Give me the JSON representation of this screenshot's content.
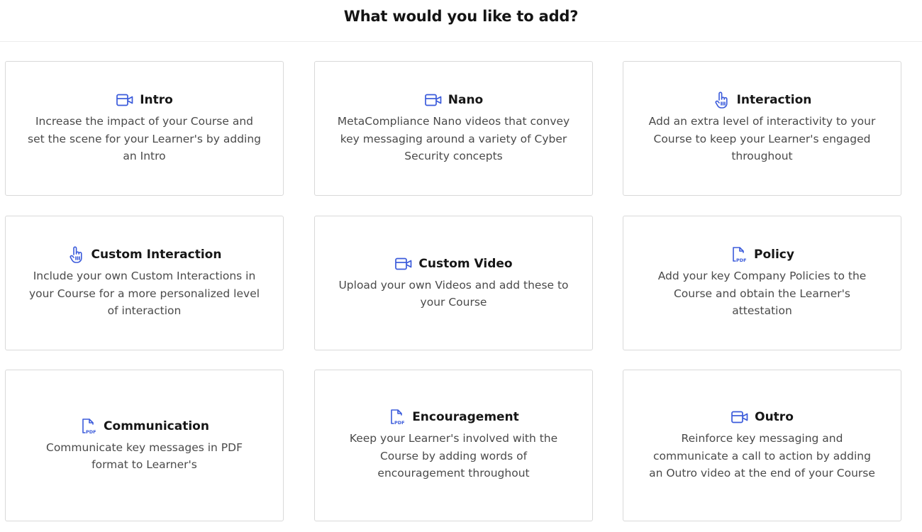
{
  "header": {
    "title": "What would you like to add?"
  },
  "theme": {
    "accent": "#3b5bdb"
  },
  "cards": [
    {
      "title": "Intro",
      "icon": "video-camera-icon",
      "description": "Increase the impact of your Course and set the scene for your Learner's by adding an Intro"
    },
    {
      "title": "Nano",
      "icon": "video-camera-icon",
      "description": "MetaCompliance Nano videos that convey key messaging around a variety of Cyber Security concepts"
    },
    {
      "title": "Interaction",
      "icon": "pointer-hand-icon",
      "description": "Add an extra level of interactivity to your Course to keep your Learner's engaged throughout"
    },
    {
      "title": "Custom Interaction",
      "icon": "pointer-hand-icon",
      "description": "Include your own Custom Interactions in your Course for a more personalized level of interaction"
    },
    {
      "title": "Custom Video",
      "icon": "video-camera-icon",
      "description": "Upload your own Videos and add these to your Course"
    },
    {
      "title": "Policy",
      "icon": "pdf-file-icon",
      "description": "Add your key Company Policies to the Course and obtain the Learner's attestation"
    },
    {
      "title": "Communication",
      "icon": "pdf-file-icon",
      "description": "Communicate key messages in PDF format to Learner's"
    },
    {
      "title": "Encouragement",
      "icon": "pdf-file-icon",
      "description": "Keep your Learner's involved with the Course by adding words of encouragement throughout"
    },
    {
      "title": "Outro",
      "icon": "video-camera-icon",
      "description": "Reinforce key messaging and communicate a call to action by adding an Outro video at the end of your Course"
    }
  ]
}
